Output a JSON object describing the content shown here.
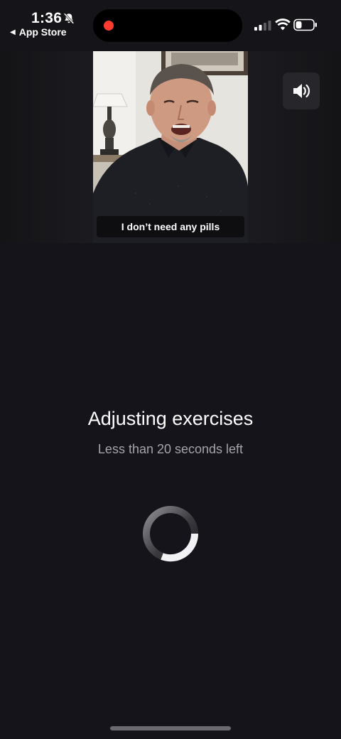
{
  "status_bar": {
    "time": "1:36",
    "back_label": "App Store",
    "back_caret": "◀",
    "icons": {
      "silent": "bell-slash-icon",
      "recording": "record-dot",
      "signal": "cellular-signal-icon",
      "wifi": "wifi-icon",
      "battery": "battery-icon"
    },
    "battery_level": 0.3,
    "signal_bars": 2
  },
  "video": {
    "caption": "I don’t need any pills",
    "sound_button_icon": "speaker-icon"
  },
  "status": {
    "title": "Adjusting exercises",
    "subtitle": "Less than 20 seconds left"
  },
  "colors": {
    "background": "#15141a",
    "record": "#ff3b30",
    "subtitle": "#a4a4ab"
  }
}
